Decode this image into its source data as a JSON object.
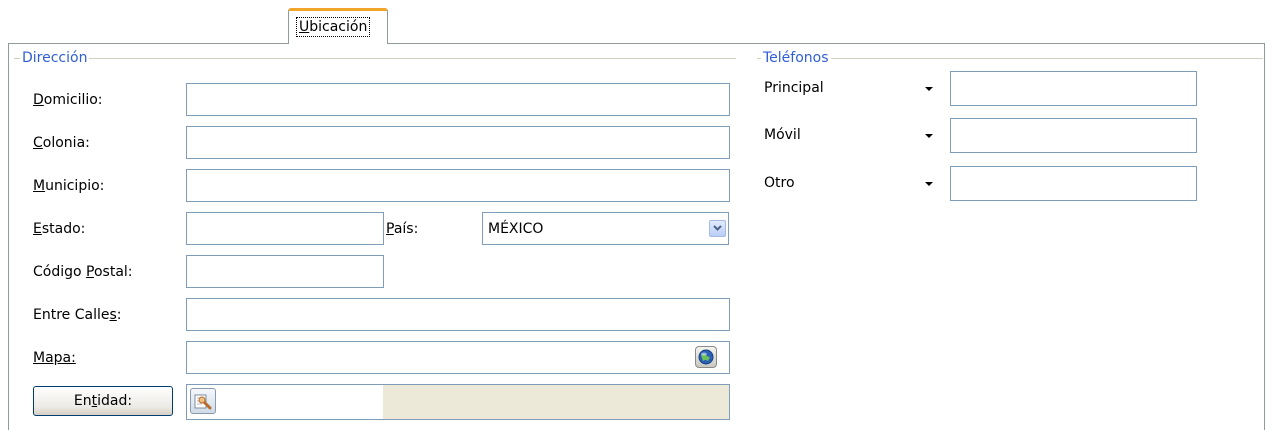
{
  "tab": {
    "label_hotkey": "U",
    "label_rest": "bicación"
  },
  "direccion": {
    "title": "Dirección",
    "domicilio": {
      "hotkey": "D",
      "rest": "omicilio:",
      "value": ""
    },
    "colonia": {
      "hotkey": "C",
      "rest": "olonia:",
      "value": ""
    },
    "municipio": {
      "hotkey": "M",
      "rest": "unicipio:",
      "value": ""
    },
    "estado": {
      "hotkey": "E",
      "rest": "stado:",
      "value": ""
    },
    "pais": {
      "hotkey": "P",
      "rest": "aís:",
      "value": "MÉXICO"
    },
    "codigo_postal": {
      "pre": "Código ",
      "hotkey": "P",
      "rest": "ostal:",
      "value": ""
    },
    "entre_calles": {
      "pre": "Entre Calle",
      "hotkey": "s",
      "rest": ":",
      "value": ""
    },
    "mapa": {
      "label": "Mapa:",
      "value": ""
    },
    "entidad": {
      "pre": "En",
      "hotkey": "t",
      "rest": "idad:",
      "value": "",
      "description": ""
    }
  },
  "telefonos": {
    "title": "Teléfonos",
    "items": [
      {
        "label": "Principal",
        "value": ""
      },
      {
        "label": "Móvil",
        "value": ""
      },
      {
        "label": "Otro",
        "value": ""
      }
    ]
  },
  "icons": {
    "combo": "chevron-down-icon",
    "map": "globe-icon",
    "entity": "search-icon",
    "phone_type": "caret-down-icon"
  },
  "colors": {
    "group_title": "#2f5fd6",
    "tab_accent": "#f3a52b",
    "border": "#7f9db9",
    "readonly_bg": "#ece9d8"
  }
}
